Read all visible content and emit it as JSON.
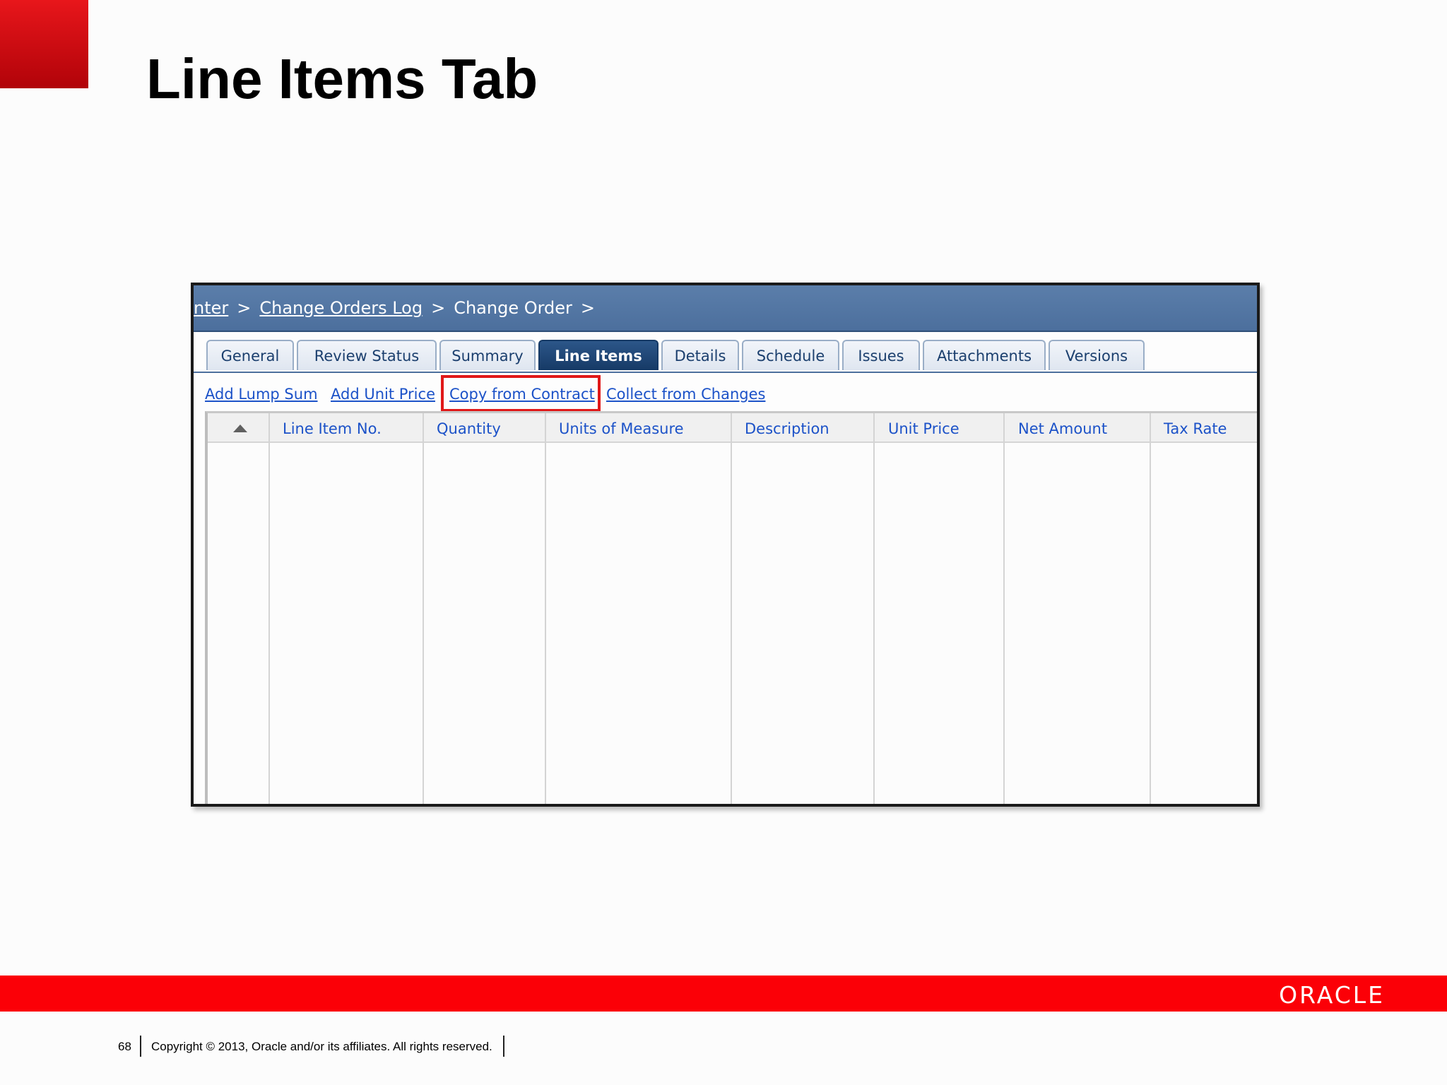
{
  "slide": {
    "title": "Line Items Tab",
    "page_number": "68",
    "copyright": "Copyright © 2013, Oracle and/or its affiliates. All rights reserved.",
    "logo_text": "ORACLE",
    "colors": {
      "red": "#fb0007",
      "dark_red": "#b10309"
    }
  },
  "app": {
    "breadcrumb": [
      {
        "label": "nter",
        "link": true
      },
      {
        "label": "Change Orders Log",
        "link": true
      },
      {
        "label": "Change Order",
        "link": false
      }
    ],
    "breadcrumb_separator": ">",
    "tabs": [
      {
        "label": "General",
        "active": false
      },
      {
        "label": "Review Status",
        "active": false
      },
      {
        "label": "Summary",
        "active": false
      },
      {
        "label": "Line Items",
        "active": true
      },
      {
        "label": "Details",
        "active": false
      },
      {
        "label": "Schedule",
        "active": false
      },
      {
        "label": "Issues",
        "active": false
      },
      {
        "label": "Attachments",
        "active": false
      },
      {
        "label": "Versions",
        "active": false
      }
    ],
    "actions": [
      {
        "label": "Add Lump Sum"
      },
      {
        "label": "Add Unit Price"
      },
      {
        "label": "Copy from Contract",
        "highlighted": true
      },
      {
        "label": "Collect from Changes"
      }
    ],
    "columns": [
      "Line Item No.",
      "Quantity",
      "Units of Measure",
      "Description",
      "Unit Price",
      "Net Amount",
      "Tax Rate"
    ],
    "colors": {
      "header_blue": "#4c6f9d",
      "link_blue": "#1c52c8",
      "highlight_red": "#e01818"
    }
  }
}
